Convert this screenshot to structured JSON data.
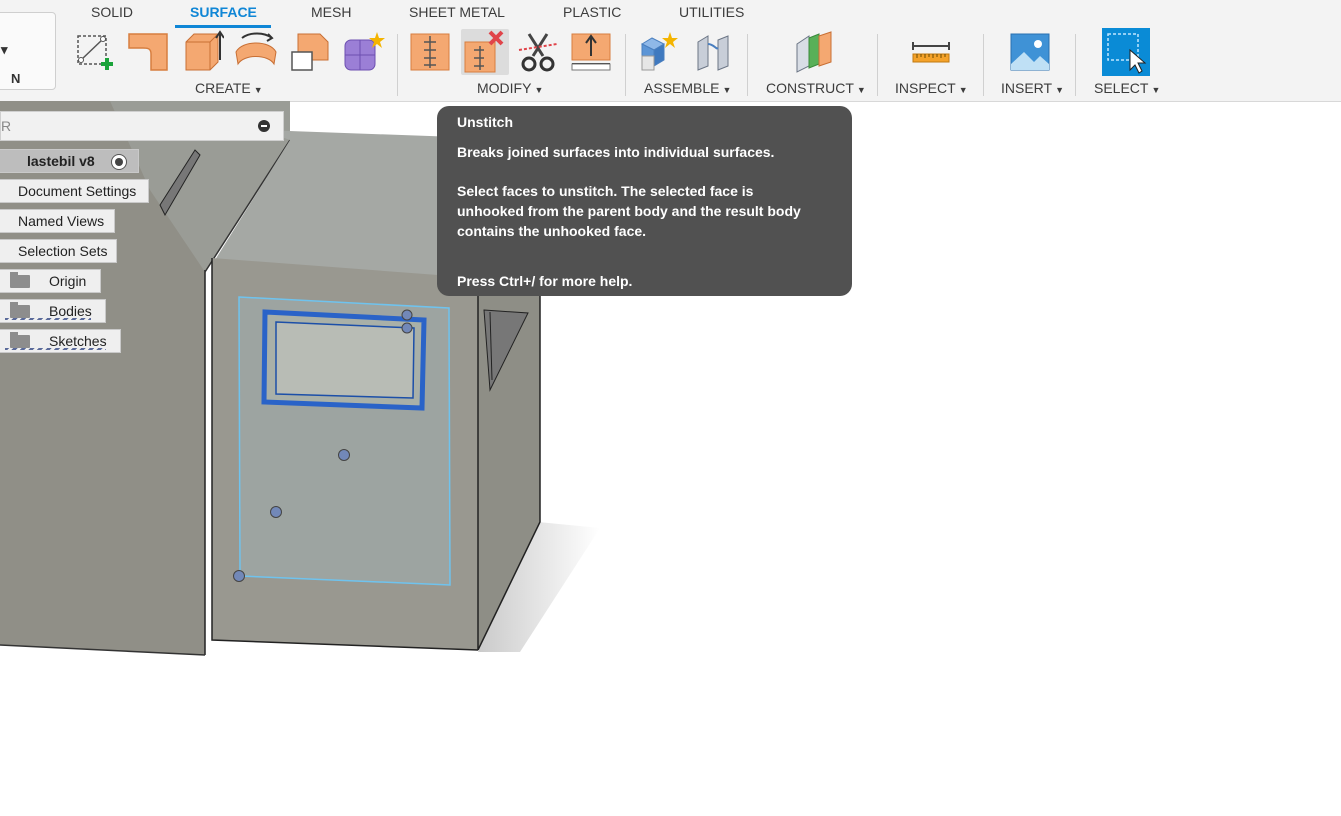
{
  "workspace": {
    "label": "N"
  },
  "tabs": [
    "SOLID",
    "SURFACE",
    "MESH",
    "SHEET METAL",
    "PLASTIC",
    "UTILITIES"
  ],
  "active_tab": "SURFACE",
  "groups": {
    "create": "CREATE",
    "modify": "MODIFY",
    "assemble": "ASSEMBLE",
    "construct": "CONSTRUCT",
    "inspect": "INSPECT",
    "insert": "INSERT",
    "select": "SELECT"
  },
  "tools": {
    "create": [
      "create-sketch-icon",
      "patch-icon",
      "extrude-icon",
      "revolve-icon",
      "offset-icon",
      "form-icon"
    ],
    "modify": [
      "stitch-icon",
      "unstitch-icon",
      "split-icon",
      "extend-icon"
    ],
    "assemble": [
      "new-component-icon",
      "joint-icon"
    ],
    "construct": [
      "plane-icon"
    ],
    "inspect": [
      "measure-icon"
    ],
    "insert": [
      "insert-image-icon"
    ],
    "select": [
      "window-select-icon"
    ]
  },
  "browser": {
    "header": "R",
    "root": "lastebil v8",
    "items": [
      "Document Settings",
      "Named Views",
      "Selection Sets",
      "Origin",
      "Bodies",
      "Sketches"
    ]
  },
  "tooltip": {
    "title": "Unstitch",
    "summary": "Breaks joined surfaces into individual surfaces.",
    "detail_lines": [
      "Select faces to unstitch. The selected face is",
      "unhooked from the parent body and the result body",
      "contains the unhooked face."
    ],
    "help": "Press Ctrl+/ for more help."
  },
  "colors": {
    "accent": "#0f86d6",
    "selection_blue": "#2a63c8",
    "tooltip_bg": "#515151",
    "model_gray": "#9a9a92"
  }
}
